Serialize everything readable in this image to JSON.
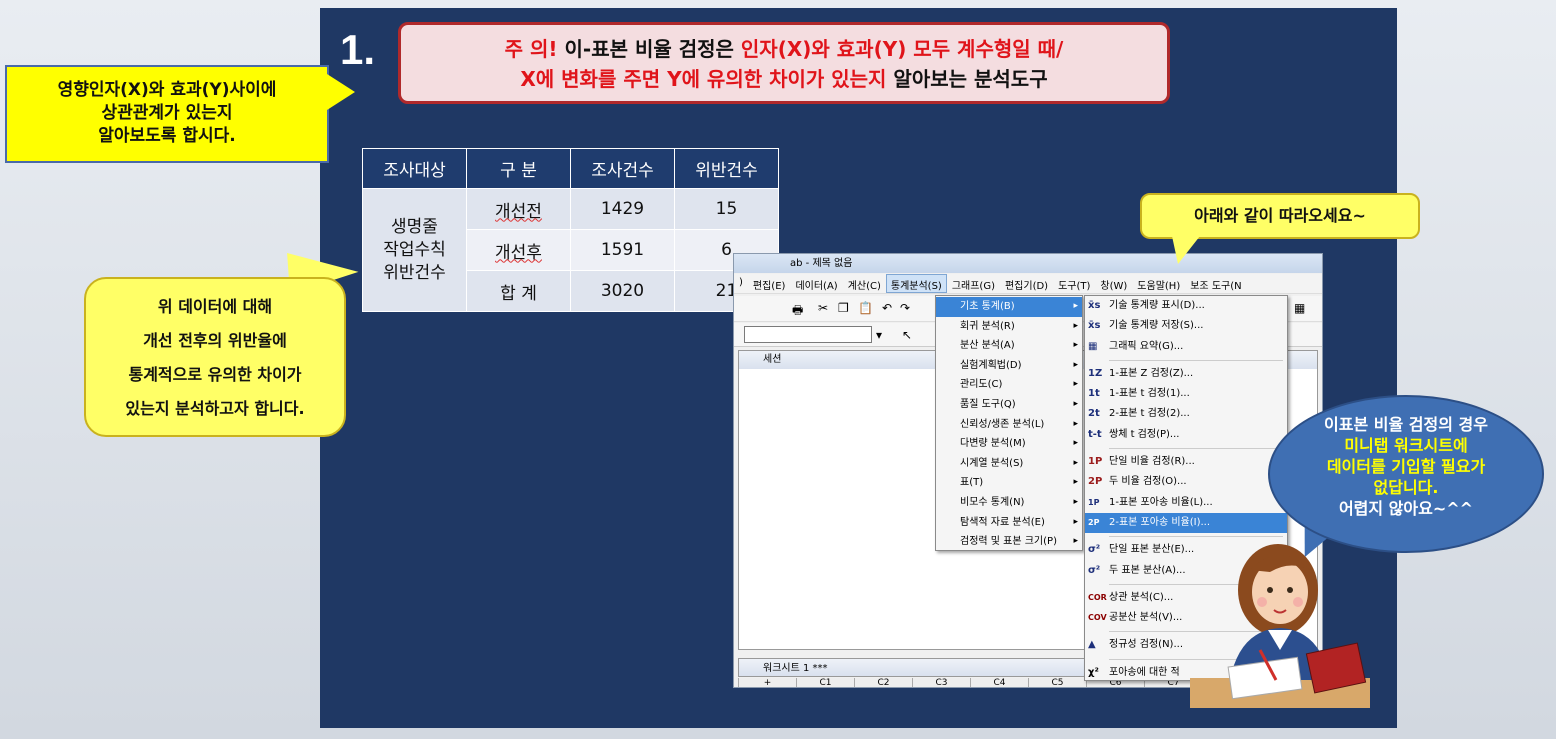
{
  "slide": {
    "number": "1.",
    "warning": {
      "p1": "주 의!",
      "p2": " 이-표본 비율 검정은 ",
      "p3": "인자(X)와 효과(Y) 모두 계수형일 때/",
      "p4": "X에 변화를 주면 Y에 유의한 차이가 있는지",
      "p5": " 알아보는 분석도구"
    }
  },
  "callouts": {
    "c1": [
      "영향인자(X)와 효과(Y)사이에",
      "상관관계가 있는지",
      "알아보도록 합시다."
    ],
    "c2": [
      "위 데이터에 대해",
      "개선 전후의 위반율에",
      "통계적으로 유의한 차이가",
      "있는지 분석하고자 합니다."
    ],
    "c3": "아래와 같이 따라오세요~",
    "c4": [
      "이표본 비율 검정의 경우",
      "미니탭 워크시트에",
      "데이터를 기입할 필요가",
      "없답니다.",
      "어렵지 않아요~^^"
    ]
  },
  "table": {
    "headers": [
      "조사대상",
      "구 분",
      "조사건수",
      "위반건수"
    ],
    "subject": [
      "생명줄",
      "작업수칙",
      "위반건수"
    ],
    "rows": [
      [
        "개선전",
        "1429",
        "15"
      ],
      [
        "개선후",
        "1591",
        "6"
      ],
      [
        "합 계",
        "3020",
        "21"
      ]
    ]
  },
  "app": {
    "title": "ab - 제목 없음",
    "menus": [
      ")",
      "편집(E)",
      "데이터(A)",
      "계산(C)",
      "통계분석(S)",
      "그래프(G)",
      "편집기(D)",
      "도구(T)",
      "창(W)",
      "도움말(H)",
      "보조 도구(N"
    ],
    "session_label": "세션",
    "worksheet_label": "워크시트 1 ***",
    "columns": [
      "+",
      "C1",
      "C2",
      "C3",
      "C4",
      "C5",
      "C6",
      "C7"
    ]
  },
  "stat_menu": [
    "기초 통계(B)",
    "회귀 분석(R)",
    "분산 분석(A)",
    "실험계획법(D)",
    "관리도(C)",
    "품질 도구(Q)",
    "신뢰성/생존 분석(L)",
    "다변량 분석(M)",
    "시계열 분석(S)",
    "표(T)",
    "비모수 통계(N)",
    "탐색적 자료 분석(E)",
    "검정력 및 표본 크기(P)"
  ],
  "basic_menu": [
    {
      "icon": "x̄s",
      "label": "기술 통계량 표시(D)..."
    },
    {
      "icon": "x̄s",
      "label": "기술 통계량 저장(S)..."
    },
    {
      "icon": "▦",
      "label": "그래픽 요약(G)..."
    },
    {
      "icon": "1Z",
      "label": "1-표본 Z 검정(Z)..."
    },
    {
      "icon": "1t",
      "label": "1-표본 t 검정(1)..."
    },
    {
      "icon": "2t",
      "label": "2-표본 t 검정(2)..."
    },
    {
      "icon": "t-t",
      "label": "쌍체 t 검정(P)..."
    },
    {
      "icon": "1P",
      "label": "단일 비율 검정(R)..."
    },
    {
      "icon": "2P",
      "label": "두 비율 검정(O)..."
    },
    {
      "icon": "1P",
      "label": "1-표본 포아송 비율(L)..."
    },
    {
      "icon": "2P",
      "label": "2-표본 포아송 비율(I)..."
    },
    {
      "icon": "σ²",
      "label": "단일 표본 분산(E)..."
    },
    {
      "icon": "σ²",
      "label": "두 표본 분산(A)..."
    },
    {
      "icon": "COR",
      "label": "상관 분석(C)..."
    },
    {
      "icon": "COV",
      "label": "공분산 분석(V)..."
    },
    {
      "icon": "▲",
      "label": "정규성 검정(N)..."
    },
    {
      "icon": "χ²",
      "label": "포아송에 대한 적"
    }
  ]
}
